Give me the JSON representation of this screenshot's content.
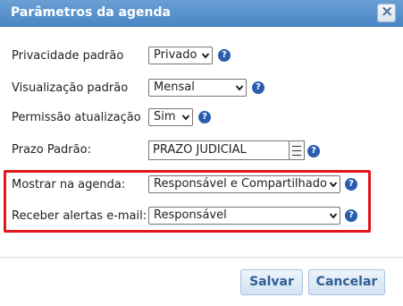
{
  "dialog": {
    "title": "Parâmetros da agenda",
    "close_glyph": "×"
  },
  "fields": {
    "privacy": {
      "label": "Privacidade padrão",
      "value": "Privado"
    },
    "view": {
      "label": "Visualização padrão",
      "value": "Mensal"
    },
    "update_permission": {
      "label": "Permissão atualização",
      "value": "Sim"
    },
    "deadline": {
      "label": "Prazo Padrão:",
      "value": "PRAZO JUDICIAL"
    },
    "show_in_agenda": {
      "label": "Mostrar na agenda:",
      "value": "Responsável e Compartilhado"
    },
    "email_alerts": {
      "label": "Receber alertas e-mail:",
      "value": "Responsável"
    }
  },
  "help_glyph": "?",
  "buttons": {
    "save": "Salvar",
    "cancel": "Cancelar"
  },
  "colors": {
    "title_bar": "#4a86c6",
    "highlight_border": "#e0161b",
    "help_icon": "#2a5db0",
    "button_text": "#2f5f95"
  }
}
